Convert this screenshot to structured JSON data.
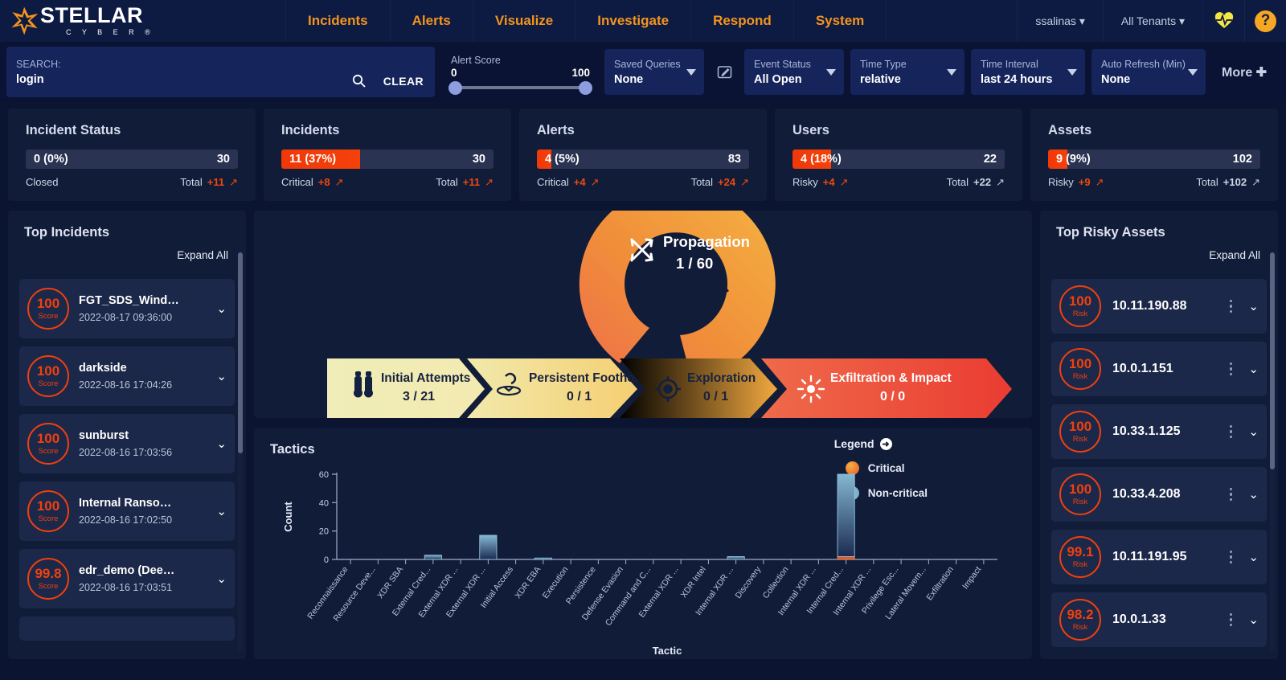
{
  "brand": {
    "name": "STELLAR",
    "sub": "C Y B E R ®"
  },
  "nav": {
    "items": [
      "Incidents",
      "Alerts",
      "Visualize",
      "Investigate",
      "Respond",
      "System"
    ],
    "user": "ssalinas ▾",
    "tenant": "All Tenants ▾",
    "health_icon": "heart-pulse-icon",
    "help_icon": "help-icon",
    "help_glyph": "?"
  },
  "filters": {
    "search_label": "SEARCH:",
    "search_value": "login",
    "search_icon": "search-icon",
    "clear_label": "CLEAR",
    "alert_score": {
      "label": "Alert Score",
      "min": "0",
      "max": "100"
    },
    "saved_queries": {
      "label": "Saved Queries",
      "value": "None"
    },
    "edit_icon": "edit-query-icon",
    "event_status": {
      "label": "Event Status",
      "value": "All Open"
    },
    "time_type": {
      "label": "Time Type",
      "value": "relative"
    },
    "time_interval": {
      "label": "Time Interval",
      "value": "last 24 hours"
    },
    "auto_refresh": {
      "label": "Auto Refresh (Min)",
      "value": "None"
    },
    "more_label": "More ✚"
  },
  "kpis": [
    {
      "title": "Incident Status",
      "bar_left": "0 (0%)",
      "bar_right": "30",
      "fill_pct": 0,
      "foot_left_label": "Closed",
      "foot_left_delta": "",
      "foot_right_label": "Total",
      "foot_right_delta": "+11",
      "right_grey": false
    },
    {
      "title": "Incidents",
      "bar_left": "11 (37%)",
      "bar_right": "30",
      "fill_pct": 37,
      "foot_left_label": "Critical",
      "foot_left_delta": "+8",
      "foot_right_label": "Total",
      "foot_right_delta": "+11",
      "right_grey": false
    },
    {
      "title": "Alerts",
      "bar_left": "4 (5%)",
      "bar_right": "83",
      "fill_pct": 5,
      "foot_left_label": "Critical",
      "foot_left_delta": "+4",
      "foot_right_label": "Total",
      "foot_right_delta": "+24",
      "right_grey": false
    },
    {
      "title": "Users",
      "bar_left": "4 (18%)",
      "bar_right": "22",
      "fill_pct": 18,
      "foot_left_label": "Risky",
      "foot_left_delta": "+4",
      "foot_right_label": "Total",
      "foot_right_delta": "+22",
      "right_grey": true
    },
    {
      "title": "Assets",
      "bar_left": "9 (9%)",
      "bar_right": "102",
      "fill_pct": 9,
      "foot_left_label": "Risky",
      "foot_left_delta": "+9",
      "foot_right_label": "Total",
      "foot_right_delta": "+102",
      "right_grey": true
    }
  ],
  "top_incidents": {
    "title": "Top Incidents",
    "expand_all": "Expand All",
    "items": [
      {
        "score": "100",
        "word": "Score",
        "name": "FGT_SDS_Wind…",
        "time": "2022-08-17 09:36:00"
      },
      {
        "score": "100",
        "word": "Score",
        "name": "darkside",
        "time": "2022-08-16 17:04:26"
      },
      {
        "score": "100",
        "word": "Score",
        "name": "sunburst",
        "time": "2022-08-16 17:03:56"
      },
      {
        "score": "100",
        "word": "Score",
        "name": "Internal Ranso…",
        "time": "2022-08-16 17:02:50"
      },
      {
        "score": "99.8",
        "word": "Score",
        "name": "edr_demo (Dee…",
        "time": "2022-08-16 17:03:51"
      }
    ]
  },
  "kill_chain": {
    "stages": [
      {
        "name": "Initial Attempts",
        "value": "3 / 21",
        "icon": "binoculars-icon"
      },
      {
        "name": "Persistent Foothold",
        "value": "0 / 1",
        "icon": "anchor-hook-icon"
      },
      {
        "name": "Exploration",
        "value": "0 / 1",
        "icon": "crosshair-icon"
      },
      {
        "name": "Exfiltration & Impact",
        "value": "0 / 0",
        "icon": "burst-icon"
      }
    ],
    "propagation": {
      "name": "Propagation",
      "value": "1 / 60",
      "icon": "shuffle-arrows-icon"
    }
  },
  "tactics_panel": {
    "title": "Tactics",
    "legend_title": "Legend",
    "legend_icon": "legend-expand-icon",
    "legend": [
      {
        "label": "Critical",
        "color": "#f08a2a"
      },
      {
        "label": "Non-critical",
        "color": "#7fb4cc"
      }
    ]
  },
  "chart_data": {
    "type": "bar",
    "title": "Tactics",
    "xlabel": "Tactic",
    "ylabel": "Count",
    "ylim": [
      0,
      60
    ],
    "yticks": [
      0,
      20,
      40,
      60
    ],
    "grid": false,
    "legend_position": "top-right",
    "stacked": true,
    "categories": [
      "Reconnaissance",
      "Resource Deve...",
      "XDR SBA",
      "External Cred...",
      "External XDR ...",
      "External XDR ...",
      "Initial Access",
      "XDR EBA",
      "Execution",
      "Persistence",
      "Defense Evasion",
      "Command and C...",
      "External XDR ...",
      "XDR Intel",
      "Internal XDR ...",
      "Discovery",
      "Collection",
      "Internal XDR ...",
      "Internal Cred...",
      "Internal XDR ...",
      "Privilege Esc...",
      "Lateral Movem...",
      "Exfiltration",
      "Impact"
    ],
    "series": [
      {
        "name": "Non-critical",
        "color": "#7fb4cc",
        "values": [
          0,
          0,
          0,
          3,
          0,
          17,
          0,
          1,
          0,
          0,
          0,
          0,
          0,
          0,
          2,
          0,
          0,
          0,
          58,
          0,
          0,
          0,
          0,
          0
        ]
      },
      {
        "name": "Critical",
        "color": "#f08a2a",
        "values": [
          0,
          0,
          0,
          0,
          0,
          0,
          0,
          0,
          0,
          0,
          0,
          0,
          0,
          0,
          0,
          0,
          0,
          0,
          2,
          0,
          0,
          0,
          0,
          0
        ]
      }
    ]
  },
  "top_assets": {
    "title": "Top Risky Assets",
    "expand_all": "Expand All",
    "items": [
      {
        "score": "100",
        "word": "Risk",
        "name": "10.11.190.88"
      },
      {
        "score": "100",
        "word": "Risk",
        "name": "10.0.1.151"
      },
      {
        "score": "100",
        "word": "Risk",
        "name": "10.33.1.125"
      },
      {
        "score": "100",
        "word": "Risk",
        "name": "10.33.4.208"
      },
      {
        "score": "99.1",
        "word": "Risk",
        "name": "10.11.191.95"
      },
      {
        "score": "98.2",
        "word": "Risk",
        "name": "10.0.1.33"
      }
    ]
  },
  "colors": {
    "brand_orange": "#f5941d",
    "critical_red": "#f0400d",
    "panel_bg": "#111c38",
    "page_bg": "#0b1430"
  }
}
